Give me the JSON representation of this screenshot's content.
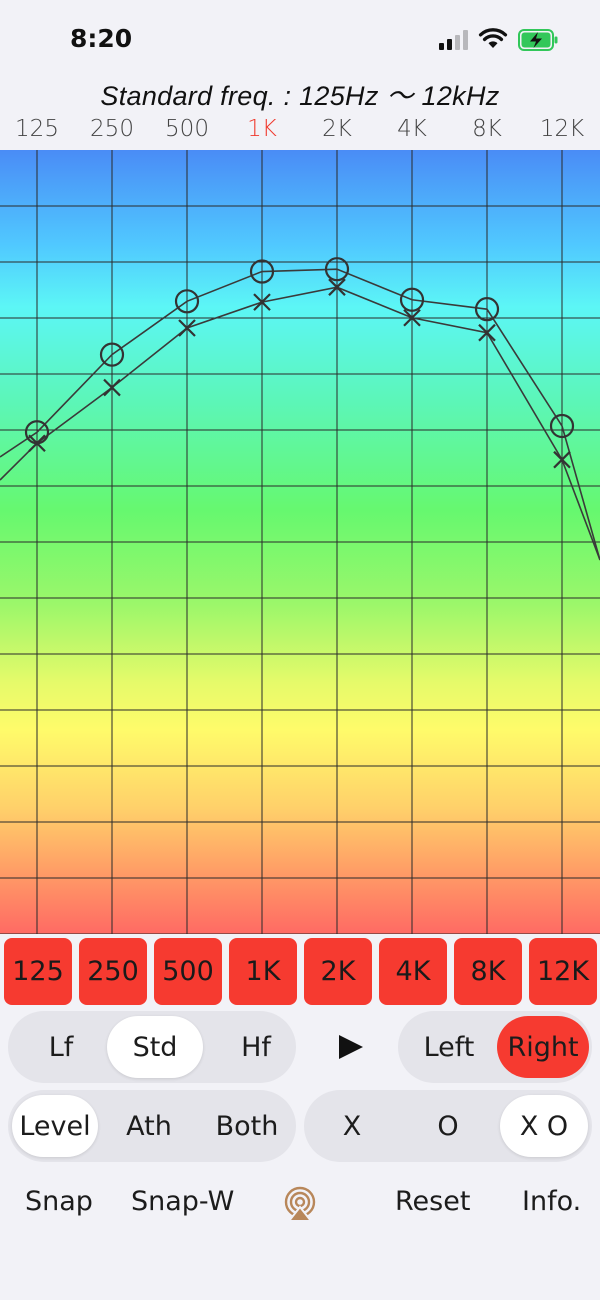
{
  "status": {
    "time": "8:20"
  },
  "title": "Standard freq. : 125Hz 〜 12kHz",
  "freq_labels": [
    "125",
    "250",
    "500",
    "1K",
    "2K",
    "4K",
    "8K",
    "12K"
  ],
  "active_freq": "1K",
  "colors": {
    "accent": "#f63a30",
    "active_label": "#f03a2e",
    "battery": "#32c75a"
  },
  "chart_data": {
    "type": "line",
    "categories": [
      "125",
      "250",
      "500",
      "1K",
      "2K",
      "4K",
      "8K",
      "12K"
    ],
    "series": [
      {
        "marker": "O",
        "values": [
          0.64,
          0.739,
          0.807,
          0.845,
          0.848,
          0.809,
          0.797,
          0.648
        ]
      },
      {
        "marker": "X",
        "values": [
          0.626,
          0.697,
          0.773,
          0.806,
          0.825,
          0.786,
          0.767,
          0.605
        ]
      }
    ]
  },
  "freq_buttons": [
    "125",
    "250",
    "500",
    "1K",
    "2K",
    "4K",
    "8K",
    "12K"
  ],
  "range_options": [
    "Lf",
    "Std",
    "Hf"
  ],
  "range_selected": "Std",
  "ear_options": [
    "Left",
    "Right"
  ],
  "ear_selected": "Right",
  "mode_options": [
    "Level",
    "Ath",
    "Both"
  ],
  "mode_selected": "Level",
  "marker_options": [
    "X",
    "O",
    "X O"
  ],
  "marker_selected": "X O",
  "bottom": {
    "snap": "Snap",
    "snap_w": "Snap-W",
    "reset": "Reset",
    "info": "Info."
  }
}
